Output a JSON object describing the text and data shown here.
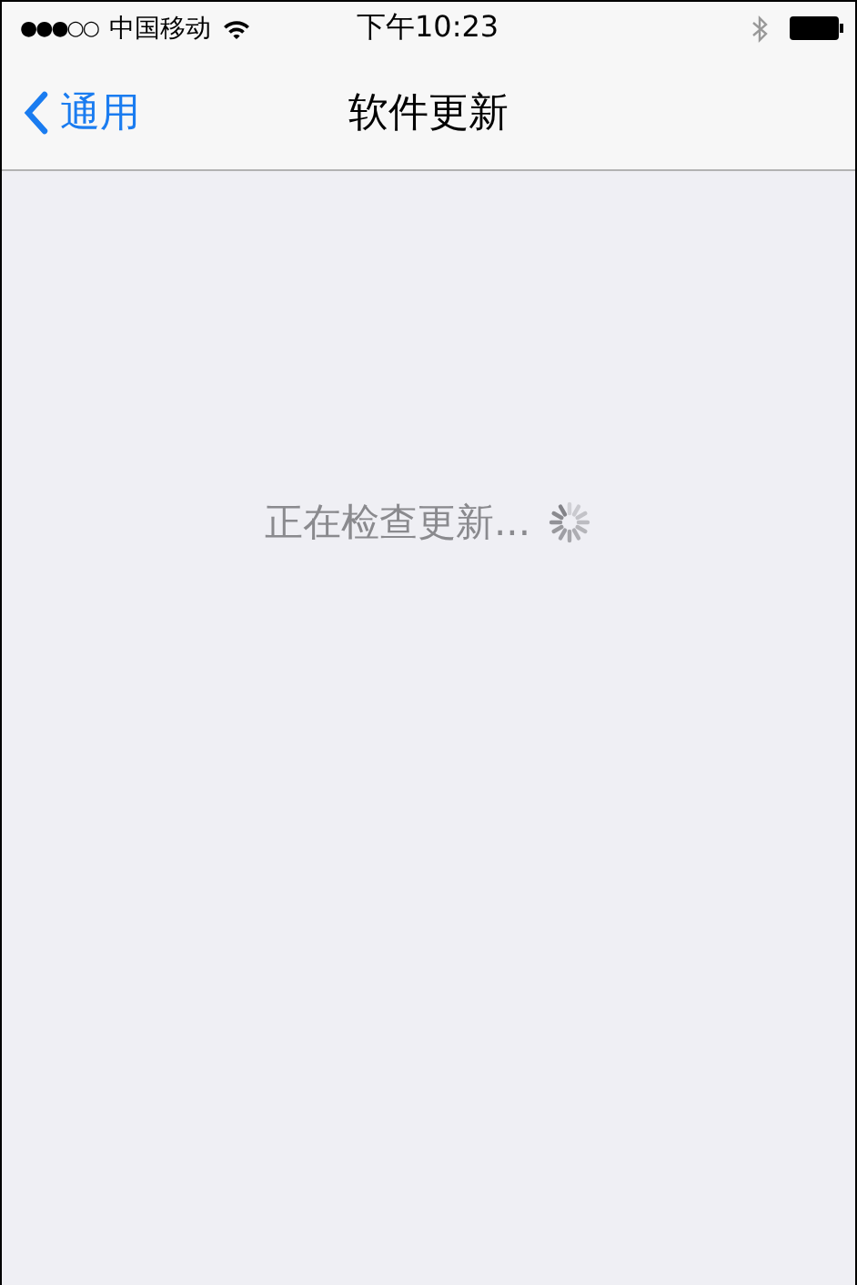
{
  "status_bar": {
    "signal": "●●●○○",
    "carrier": "中国移动",
    "time": "下午10:23"
  },
  "nav_bar": {
    "back_label": "通用",
    "title": "软件更新"
  },
  "content": {
    "message": "正在检查更新..."
  }
}
